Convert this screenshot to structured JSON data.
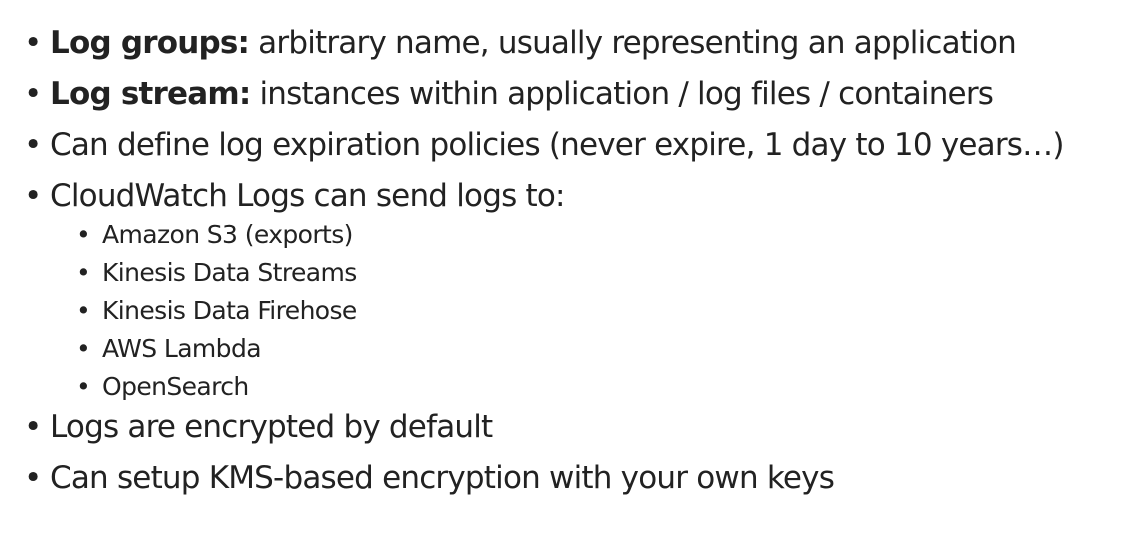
{
  "bullets": [
    {
      "label": "Log groups:",
      "text": " arbitrary name, usually representing an application"
    },
    {
      "label": "Log stream:",
      "text": " instances within application / log files / containers"
    },
    {
      "text": "Can define log expiration policies (never expire, 1 day to 10 years…)"
    },
    {
      "text": "CloudWatch Logs can send logs to:"
    },
    {
      "text": "Logs are encrypted by default"
    },
    {
      "text": "Can setup KMS-based encryption with your own keys"
    }
  ],
  "destinations": [
    "Amazon S3 (exports)",
    "Kinesis Data Streams",
    "Kinesis Data Firehose",
    "AWS Lambda",
    "OpenSearch"
  ]
}
